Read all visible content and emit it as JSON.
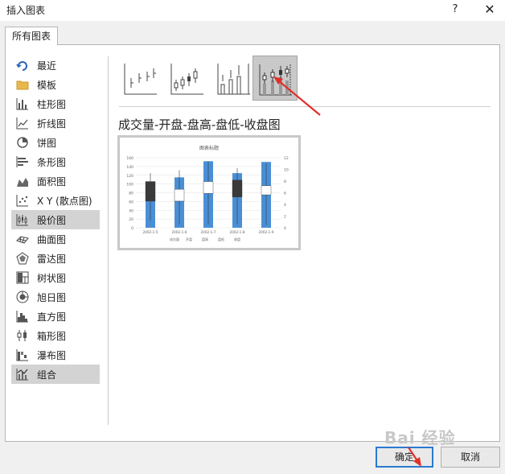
{
  "dialog": {
    "title": "插入图表",
    "help": "?",
    "close": "✕"
  },
  "tabs": [
    {
      "label": "所有图表"
    }
  ],
  "sidebar": {
    "items": [
      {
        "label": "最近",
        "icon": "recent-icon"
      },
      {
        "label": "模板",
        "icon": "folder-icon"
      },
      {
        "label": "柱形图",
        "icon": "column-chart-icon"
      },
      {
        "label": "折线图",
        "icon": "line-chart-icon"
      },
      {
        "label": "饼图",
        "icon": "pie-chart-icon"
      },
      {
        "label": "条形图",
        "icon": "bar-chart-icon"
      },
      {
        "label": "面积图",
        "icon": "area-chart-icon"
      },
      {
        "label": "X Y (散点图)",
        "icon": "scatter-chart-icon"
      },
      {
        "label": "股价图",
        "icon": "stock-chart-icon",
        "selected": true
      },
      {
        "label": "曲面图",
        "icon": "surface-chart-icon"
      },
      {
        "label": "雷达图",
        "icon": "radar-chart-icon"
      },
      {
        "label": "树状图",
        "icon": "treemap-chart-icon"
      },
      {
        "label": "旭日图",
        "icon": "sunburst-chart-icon"
      },
      {
        "label": "直方图",
        "icon": "histogram-chart-icon"
      },
      {
        "label": "箱形图",
        "icon": "box-whisker-chart-icon"
      },
      {
        "label": "瀑布图",
        "icon": "waterfall-chart-icon"
      },
      {
        "label": "组合",
        "icon": "combo-chart-icon",
        "selected": true
      }
    ]
  },
  "subtype": {
    "title": "成交量-开盘-盘高-盘低-收盘图"
  },
  "preview": {
    "chart_title": "图表标题",
    "left_ticks": [
      "160",
      "140",
      "120",
      "100",
      "80",
      "60",
      "40",
      "20",
      "0"
    ],
    "right_ticks": [
      "12",
      "10",
      "8",
      "6",
      "4",
      "2",
      "0"
    ],
    "categories": [
      "2002-1-5",
      "2002-1-6",
      "2002-1-7",
      "2002-1-8",
      "2002-1-9"
    ],
    "legend": [
      "成交量",
      "开盘",
      "盘高",
      "盘低",
      "收盘"
    ]
  },
  "buttons": {
    "ok": "确定",
    "cancel": "取消"
  },
  "watermark": "Bai 经验",
  "colors": {
    "bar": "#4a8fd6",
    "selected_bg": "#d3d3d3",
    "focus": "#2a7ad1",
    "arrow": "#e0302a"
  }
}
